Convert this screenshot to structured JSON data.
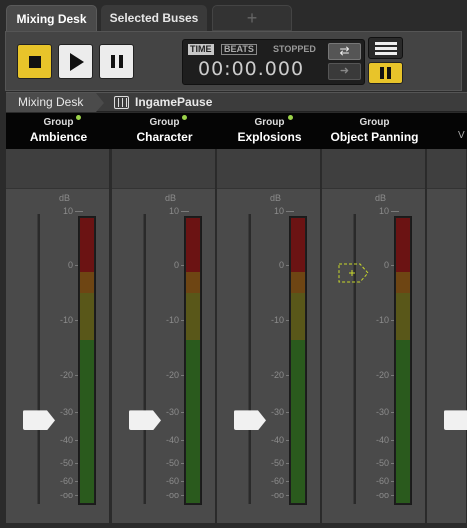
{
  "tabs": [
    {
      "label": "Mixing Desk",
      "active": true
    },
    {
      "label": "Selected Buses",
      "active": false
    },
    {
      "label": "+",
      "active": false
    }
  ],
  "transport": {
    "time_label": "TIME",
    "beats_label": "BEATS",
    "status": "STOPPED",
    "time_value": "00:00.000",
    "loop_glyph": "⇄",
    "next_glyph": "➜"
  },
  "breadcrumb": {
    "root": "Mixing Desk",
    "current": "IngamePause"
  },
  "scale": {
    "unit": "dB",
    "marks": [
      "10",
      "0",
      "-10",
      "-20",
      "-30",
      "-40",
      "-50",
      "-60",
      "-oo"
    ]
  },
  "channels": [
    {
      "type": "Group",
      "name": "Ambience",
      "fader_db": -33,
      "indicator": true
    },
    {
      "type": "Group",
      "name": "Character",
      "fader_db": -33,
      "indicator": true
    },
    {
      "type": "Group",
      "name": "Explosions",
      "fader_db": -33,
      "indicator": true
    },
    {
      "type": "Group",
      "name": "Object Panning",
      "fader_db": null,
      "indicator": false
    }
  ],
  "colors": {
    "accent": "#e8c42a",
    "indicator": "#9bd24a",
    "ghost_fader": "#c8d82a"
  }
}
